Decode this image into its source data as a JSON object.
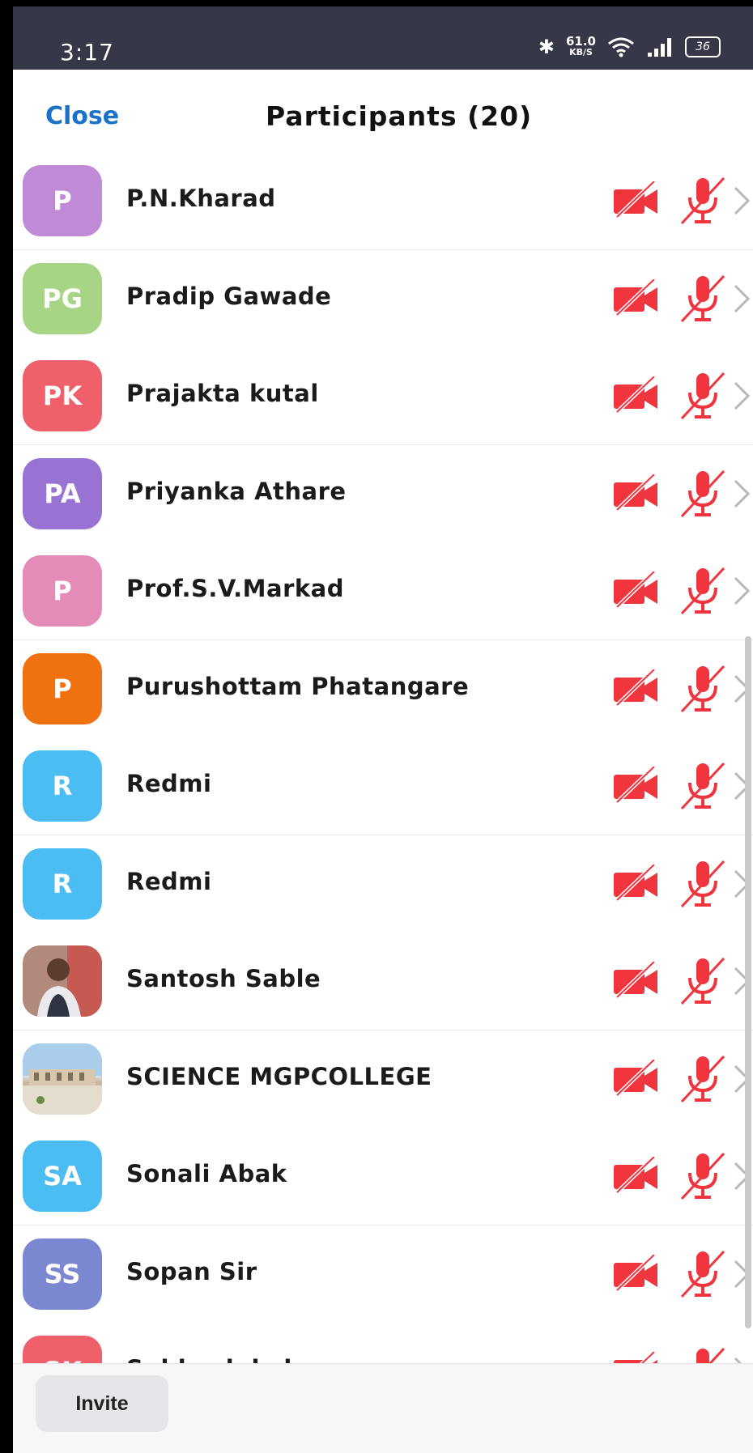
{
  "status_bar": {
    "time": "3:17",
    "bluetooth_icon": "bluetooth-icon",
    "net_speed_value": "61.0",
    "net_speed_unit": "KB/S",
    "battery_level": "36"
  },
  "header": {
    "close_label": "Close",
    "title": "Participants (20)"
  },
  "participants": [
    {
      "initials": "P",
      "name": "P.N.Kharad",
      "color": "#c18ad6",
      "photo": "none"
    },
    {
      "initials": "PG",
      "name": "Pradip Gawade",
      "color": "#a8d486",
      "photo": "none"
    },
    {
      "initials": "PK",
      "name": "Prajakta kutal",
      "color": "#f0606a",
      "photo": "none"
    },
    {
      "initials": "PA",
      "name": "Priyanka Athare",
      "color": "#9973d3",
      "photo": "none"
    },
    {
      "initials": "P",
      "name": "Prof.S.V.Markad",
      "color": "#e58bb7",
      "photo": "none"
    },
    {
      "initials": "P",
      "name": "Purushottam Phatangare",
      "color": "#f07110",
      "photo": "none"
    },
    {
      "initials": "R",
      "name": "Redmi",
      "color": "#4cbdf2",
      "photo": "none"
    },
    {
      "initials": "R",
      "name": "Redmi",
      "color": "#4cbdf2",
      "photo": "none"
    },
    {
      "initials": "",
      "name": "Santosh Sable",
      "color": "#8a8a8a",
      "photo": "person"
    },
    {
      "initials": "",
      "name": "SCIENCE MGPCOLLEGE",
      "color": "#b0c8de",
      "photo": "building"
    },
    {
      "initials": "SA",
      "name": "Sonali Abak",
      "color": "#4cbdf2",
      "photo": "none"
    },
    {
      "initials": "SS",
      "name": "Sopan Sir",
      "color": "#7b88d1",
      "photo": "none"
    },
    {
      "initials": "SK",
      "name": "Subhash kale",
      "color": "#f0606a",
      "photo": "none"
    }
  ],
  "row_icons": {
    "video": "video-off-icon",
    "mic": "mic-off-icon",
    "chevron": "chevron-right-icon",
    "muted_color": "#f0353f"
  },
  "footer": {
    "invite_label": "Invite"
  }
}
